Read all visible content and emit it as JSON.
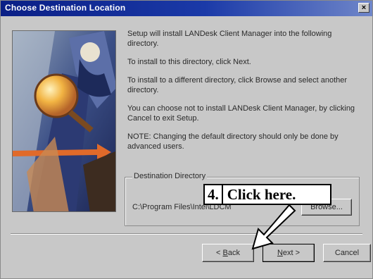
{
  "window": {
    "title": "Choose Destination Location",
    "close_symbol": "×"
  },
  "body": {
    "paragraphs": [
      "Setup will install LANDesk Client Manager into the following directory.",
      "To install to this directory, click Next.",
      "To install to a different directory, click Browse and select another directory.",
      "You can choose not to install LANDesk Client Manager, by clicking Cancel to exit Setup.",
      "NOTE:  Changing the default directory should only be done by advanced users."
    ]
  },
  "destination": {
    "group_label": "Destination Directory",
    "path": "C:\\Program Files\\Intel\\LDCM",
    "browse_label": "Browse..."
  },
  "buttons": {
    "back_prefix": "< ",
    "back_accel": "B",
    "back_rest": "ack",
    "next_accel": "N",
    "next_rest": "ext >",
    "cancel_label": "Cancel"
  },
  "callout": {
    "number": "4.",
    "text": "Click here."
  },
  "icons": {
    "close": "close-icon",
    "arrow": "pointer-arrow-icon"
  }
}
